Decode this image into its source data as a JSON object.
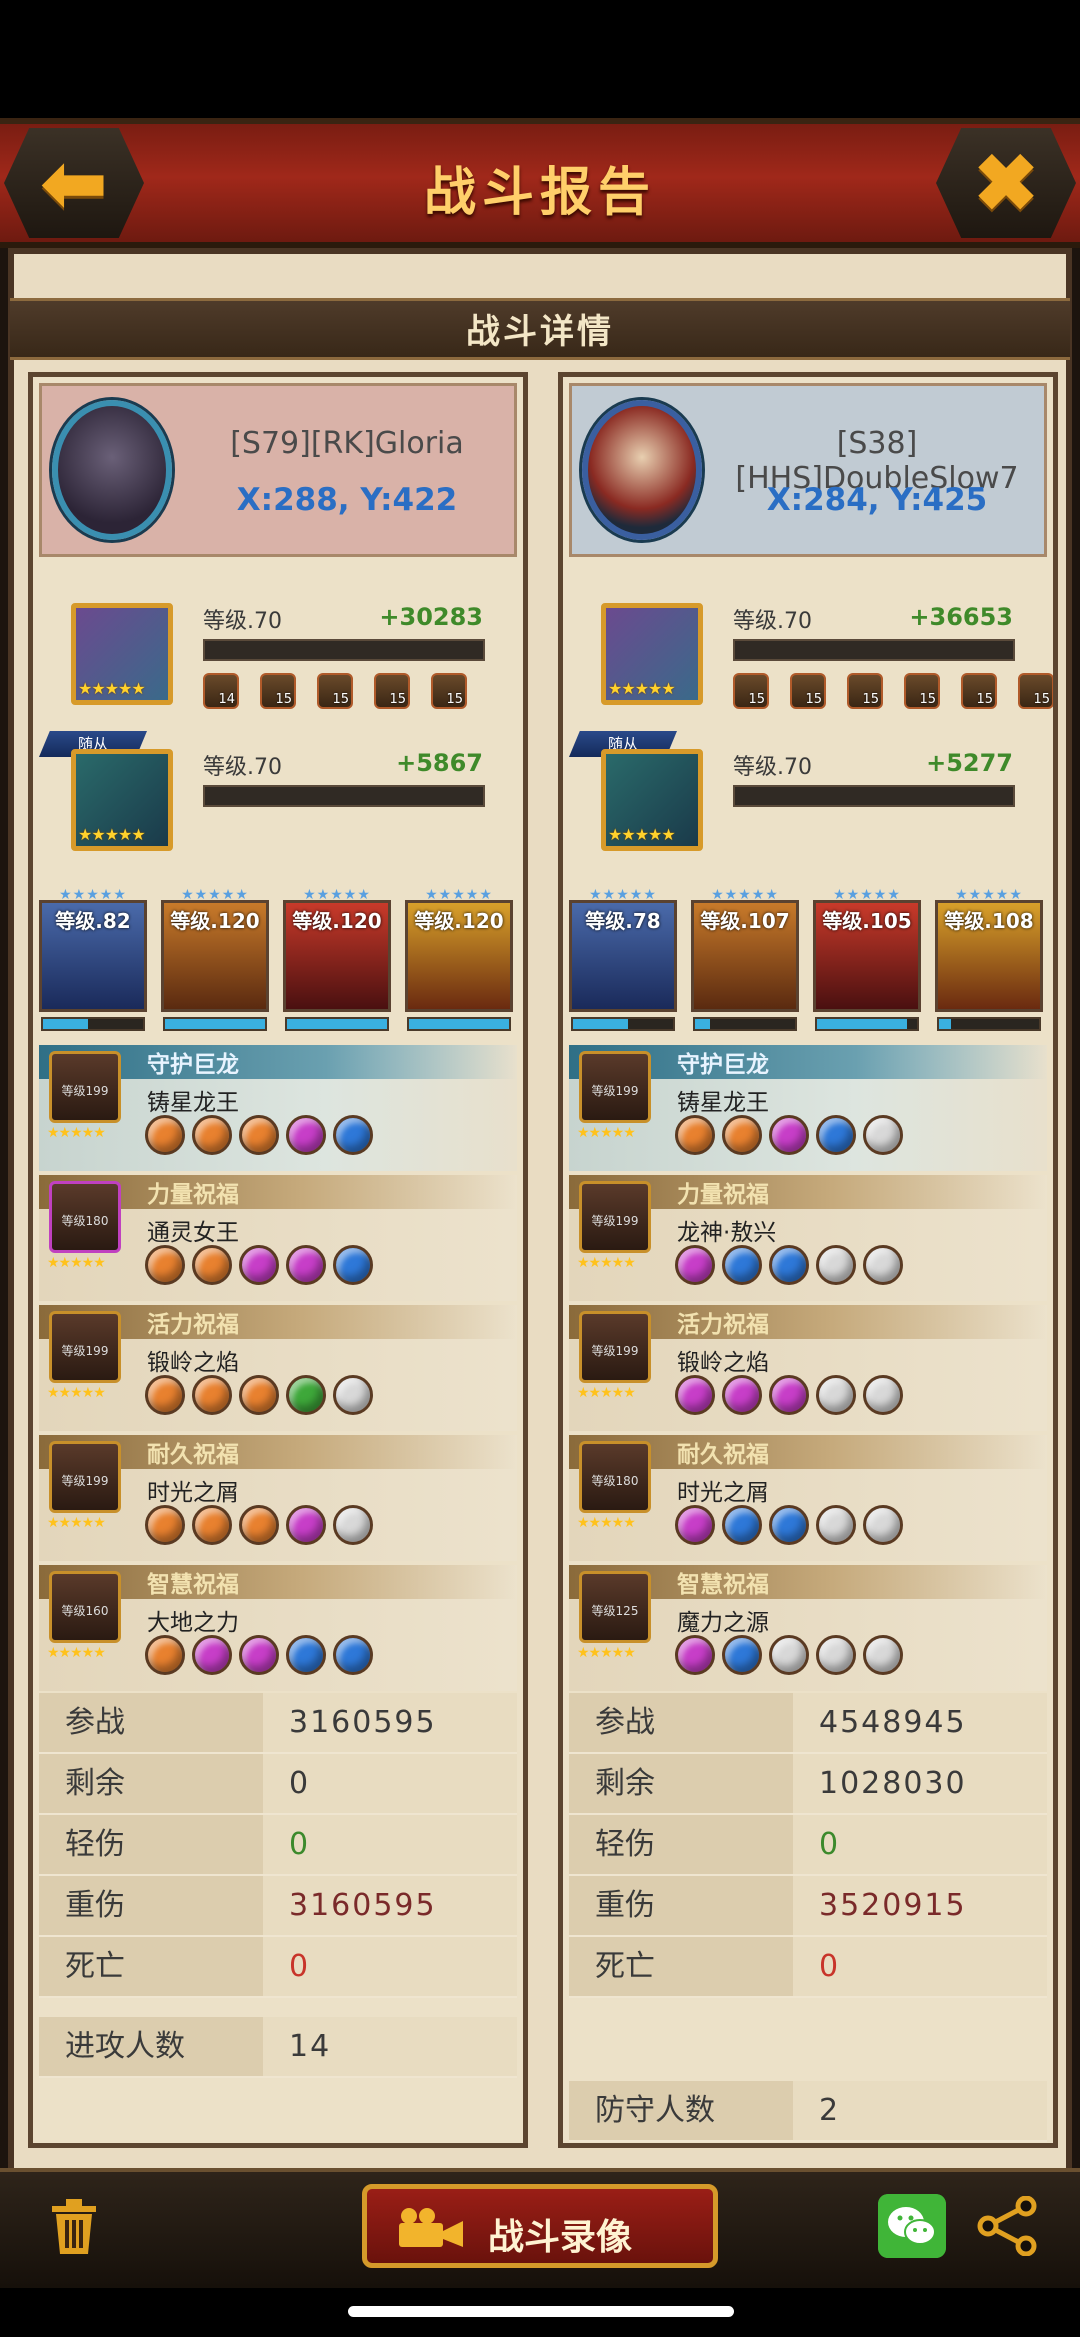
{
  "header": {
    "title": "战斗报告",
    "back_icon": "back-arrow-icon",
    "close_icon": "close-icon"
  },
  "subheader": {
    "title": "战斗详情"
  },
  "attacker": {
    "player_name": "[S79][RK]Gloria",
    "coords": "X:288, Y:422",
    "hero": {
      "level": "等级.70",
      "power": "+30283",
      "equips": [
        {
          "n": "14"
        },
        {
          "n": "15"
        },
        {
          "n": "15"
        },
        {
          "n": "15"
        },
        {
          "n": "15"
        }
      ]
    },
    "follower": {
      "tag": "随从",
      "level": "等级.70",
      "power": "+5867"
    },
    "dragons": [
      {
        "level": "等级.82",
        "exp": 0.45
      },
      {
        "level": "等级.120",
        "exp": 1.0
      },
      {
        "level": "等级.120",
        "exp": 1.0
      },
      {
        "level": "等级.120",
        "exp": 1.0
      }
    ],
    "blessings": [
      {
        "category": "守护巨龙",
        "name": "铸星龙王",
        "icon_level": "等级199",
        "gems": [
          "orange",
          "orange",
          "orange",
          "purple",
          "blue"
        ]
      },
      {
        "category": "力量祝福",
        "name": "通灵女王",
        "icon_level": "等级180",
        "gems": [
          "orange",
          "orange",
          "purple",
          "purple",
          "blue"
        ]
      },
      {
        "category": "活力祝福",
        "name": "锻岭之焰",
        "icon_level": "等级199",
        "gems": [
          "orange",
          "orange",
          "orange",
          "green",
          "white"
        ]
      },
      {
        "category": "耐久祝福",
        "name": "时光之屑",
        "icon_level": "等级199",
        "gems": [
          "orange",
          "orange",
          "orange",
          "purple",
          "white"
        ]
      },
      {
        "category": "智慧祝福",
        "name": "大地之力",
        "icon_level": "等级160",
        "gems": [
          "orange",
          "purple",
          "purple",
          "blue",
          "blue"
        ]
      }
    ],
    "stats": [
      {
        "label": "参战",
        "value": "3160595",
        "color": "#3a3a3a"
      },
      {
        "label": "剩余",
        "value": "0",
        "color": "#3a3a3a"
      },
      {
        "label": "轻伤",
        "value": "0",
        "color": "#3c8a2c"
      },
      {
        "label": "重伤",
        "value": "3160595",
        "color": "#7a2a2a"
      },
      {
        "label": "死亡",
        "value": "0",
        "color": "#c8342a"
      }
    ],
    "count_label": "进攻人数",
    "count_value": "14"
  },
  "defender": {
    "player_name": "[S38][HHS]DoubleSlow7",
    "coords": "X:284, Y:425",
    "hero": {
      "level": "等级.70",
      "power": "+36653",
      "equips": [
        {
          "n": "15"
        },
        {
          "n": "15"
        },
        {
          "n": "15"
        },
        {
          "n": "15"
        },
        {
          "n": "15"
        },
        {
          "n": "15"
        }
      ]
    },
    "follower": {
      "tag": "随从",
      "level": "等级.70",
      "power": "+5277"
    },
    "dragons": [
      {
        "level": "等级.78",
        "exp": 0.55
      },
      {
        "level": "等级.107",
        "exp": 0.15
      },
      {
        "level": "等级.105",
        "exp": 0.9
      },
      {
        "level": "等级.108",
        "exp": 0.12
      }
    ],
    "blessings": [
      {
        "category": "守护巨龙",
        "name": "铸星龙王",
        "icon_level": "等级199",
        "gems": [
          "orange",
          "orange",
          "purple",
          "blue",
          "white"
        ]
      },
      {
        "category": "力量祝福",
        "name": "龙神·敖兴",
        "icon_level": "等级199",
        "gems": [
          "purple",
          "blue",
          "blue",
          "white",
          "white"
        ]
      },
      {
        "category": "活力祝福",
        "name": "锻岭之焰",
        "icon_level": "等级199",
        "gems": [
          "purple",
          "purple",
          "purple",
          "white",
          "white"
        ]
      },
      {
        "category": "耐久祝福",
        "name": "时光之屑",
        "icon_level": "等级180",
        "gems": [
          "purple",
          "blue",
          "blue",
          "white",
          "white"
        ]
      },
      {
        "category": "智慧祝福",
        "name": "魔力之源",
        "icon_level": "等级125",
        "gems": [
          "purple",
          "blue",
          "white",
          "white",
          "white"
        ]
      }
    ],
    "stats": [
      {
        "label": "参战",
        "value": "4548945",
        "color": "#3a3a3a"
      },
      {
        "label": "剩余",
        "value": "1028030",
        "color": "#3a3a3a"
      },
      {
        "label": "轻伤",
        "value": "0",
        "color": "#3c8a2c"
      },
      {
        "label": "重伤",
        "value": "3520915",
        "color": "#7a2a2a"
      },
      {
        "label": "死亡",
        "value": "0",
        "color": "#c8342a"
      }
    ],
    "count_label": "防守人数",
    "count_value": "2"
  },
  "footer": {
    "record_label": "战斗录像",
    "trash_icon": "trash-icon",
    "video_icon": "video-camera-icon",
    "wechat_icon": "wechat-icon",
    "share_icon": "share-icon"
  },
  "colors": {
    "accent": "#f2a821",
    "title_red": "#a0281a",
    "coords_blue": "#2a6ec4",
    "power_green": "#3f8a2a"
  }
}
